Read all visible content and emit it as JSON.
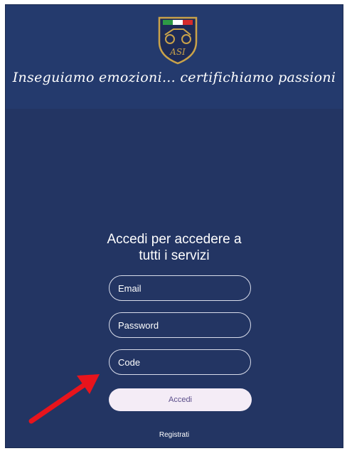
{
  "header": {
    "logo_text": "ASI",
    "tagline": "Inseguiamo emozioni... certifichiamo passioni"
  },
  "login": {
    "heading_line1": "Accedi per accedere a",
    "heading_line2": "tutti i servizi",
    "email_placeholder": "Email",
    "password_placeholder": "Password",
    "code_placeholder": "Code",
    "submit_label": "Accedi",
    "register_label": "Registrati"
  },
  "colors": {
    "background": "#233563",
    "header": "#243a6d",
    "button": "#f4ecf6",
    "arrow": "#e8141c"
  },
  "annotation": {
    "arrow_icon": "red-arrow-icon"
  }
}
